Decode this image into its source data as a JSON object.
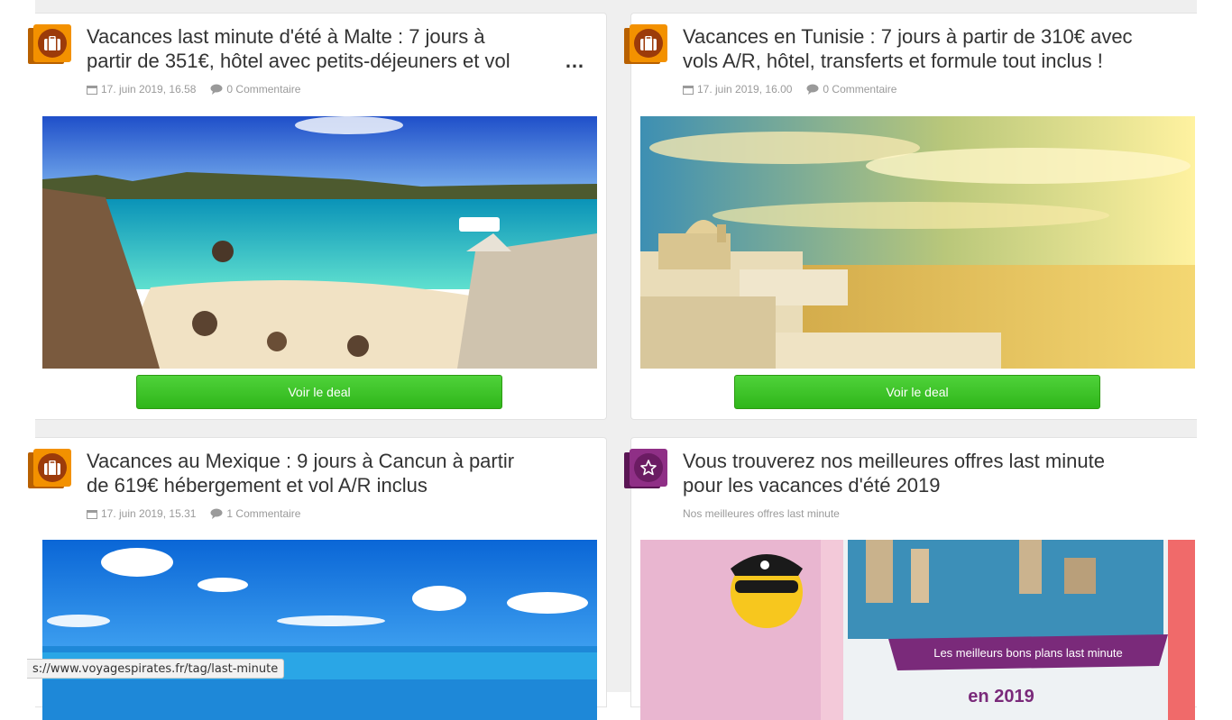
{
  "cards": [
    {
      "category_icon": "suitcase-icon",
      "title_line1": "Vacances last minute d'été à Malte : 7 jours à",
      "title_line2": "partir de 351€, hôtel avec petits-déjeuners et vol",
      "title_more": "…",
      "date": "17. juin 2019, 16.58",
      "comments": "0 Commentaire",
      "button": "Voir le deal"
    },
    {
      "category_icon": "suitcase-icon",
      "title_line1": "Vacances en Tunisie : 7 jours à partir de 310€ avec",
      "title_line2": "vols A/R, hôtel, transferts et formule tout inclus !",
      "date": "17. juin 2019, 16.00",
      "comments": "0 Commentaire",
      "button": "Voir le deal"
    },
    {
      "category_icon": "suitcase-icon",
      "title_line1": "Vacances au Mexique : 9 jours à Cancun à partir",
      "title_line2": "de 619€ hébergement et vol A/R inclus",
      "date": "17. juin 2019, 15.31",
      "comments": "1 Commentaire"
    },
    {
      "category_icon": "star-icon",
      "title_line1": "Vous trouverez nos meilleures offres last minute",
      "title_line2": "pour les vacances d'été 2019",
      "subtitle": "Nos meilleures offres last minute",
      "banner_ribbon": "Les meilleurs bons plans last minute",
      "banner_year": "en 2019"
    }
  ],
  "status_url": "s://www.voyagespirates.fr/tag/last-minute",
  "colors": {
    "badge_orange": "#f39100",
    "badge_purple": "#8f2f86",
    "deal_green": "#36bd1f"
  }
}
